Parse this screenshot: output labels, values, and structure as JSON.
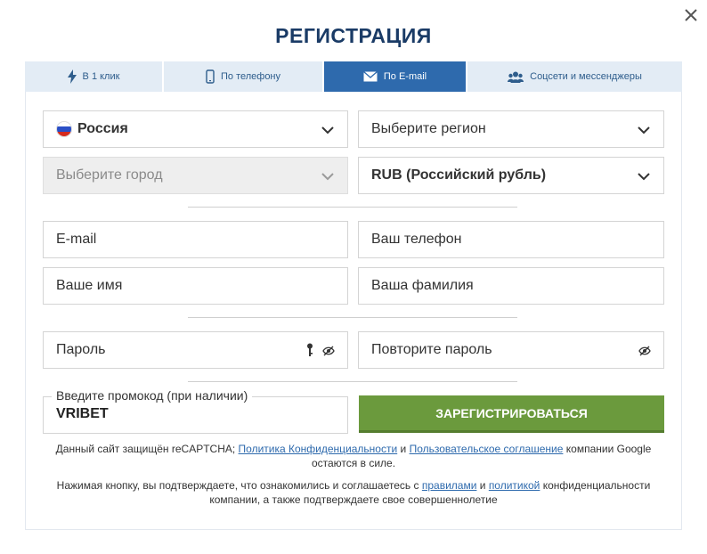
{
  "title": "РЕГИСТРАЦИЯ",
  "tabs": [
    {
      "label": "В 1 клик",
      "icon": "lightning-icon"
    },
    {
      "label": "По телефону",
      "icon": "phone-icon"
    },
    {
      "label": "По E-mail",
      "icon": "envelope-icon",
      "active": true
    },
    {
      "label": "Соцсети и мессенджеры",
      "icon": "users-icon"
    }
  ],
  "form": {
    "country": "Россия",
    "region": "Выберите регион",
    "city": "Выберите город",
    "currency": "RUB (Российский рубль)",
    "email": "E-mail",
    "phone": "Ваш телефон",
    "first_name": "Ваше имя",
    "last_name": "Ваша фамилия",
    "password": "Пароль",
    "password_repeat": "Повторите пароль",
    "promo_label": "Введите промокод (при наличии)",
    "promo_value": "VRIBET",
    "submit": "ЗАРЕГИСТРИРОВАТЬСЯ"
  },
  "legal": {
    "recaptcha_prefix": "Данный сайт защищён reCAPTCHA;",
    "privacy_link": "Политика Конфиденциальности",
    "and": "и",
    "terms_link": "Пользовательское соглашение",
    "recaptcha_suffix": "компании Google остаются в силе.",
    "consent_prefix": "Нажимая кнопку, вы подтверждаете, что ознакомились и соглашаетесь с",
    "rules_link": "правилами",
    "and2": "и",
    "policy_link": "политикой",
    "consent_suffix": "конфиденциальности компании, а также подтверждаете свое совершеннолетие"
  },
  "colors": {
    "title": "#1a3b66",
    "tab_bg": "#e3ecf5",
    "tab_active": "#2e6aad",
    "submit_bg": "#6b9a3d",
    "link": "#2e6aad"
  }
}
